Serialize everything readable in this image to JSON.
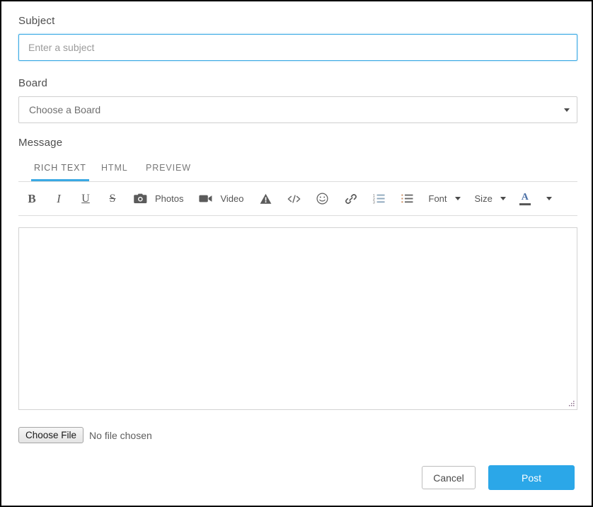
{
  "form": {
    "subject": {
      "label": "Subject",
      "placeholder": "Enter a subject",
      "value": "",
      "focus_border_color": "#3aa9e4"
    },
    "board": {
      "label": "Board",
      "selected": "Choose a Board",
      "arrow_icon": "chevron-down-icon"
    },
    "message": {
      "label": "Message",
      "tabs": [
        {
          "label": "RICH TEXT",
          "active": true
        },
        {
          "label": "HTML",
          "active": false
        },
        {
          "label": "PREVIEW",
          "active": false
        }
      ],
      "active_tab_underline_color": "#3aa9e4",
      "toolbar": [
        {
          "name": "bold-button",
          "icon": "bold-icon",
          "glyph": "B",
          "label": ""
        },
        {
          "name": "italic-button",
          "icon": "italic-icon",
          "glyph": "I",
          "label": ""
        },
        {
          "name": "underline-button",
          "icon": "underline-icon",
          "glyph": "U",
          "label": ""
        },
        {
          "name": "strikethrough-button",
          "icon": "strikethrough-icon",
          "glyph": "S",
          "label": ""
        },
        {
          "name": "photos-button",
          "icon": "camera-icon",
          "label": "Photos"
        },
        {
          "name": "video-button",
          "icon": "video-camera-icon",
          "label": "Video"
        },
        {
          "name": "spoiler-button",
          "icon": "warning-triangle-icon",
          "label": ""
        },
        {
          "name": "code-button",
          "icon": "code-icon",
          "label": ""
        },
        {
          "name": "emoji-button",
          "icon": "smiley-face-icon",
          "label": ""
        },
        {
          "name": "link-button",
          "icon": "link-icon",
          "label": ""
        },
        {
          "name": "ordered-list-button",
          "icon": "ordered-list-icon",
          "label": ""
        },
        {
          "name": "unordered-list-button",
          "icon": "bulleted-list-icon",
          "label": ""
        },
        {
          "name": "font-dropdown",
          "icon": "chevron-down-icon",
          "label": "Font"
        },
        {
          "name": "size-dropdown",
          "icon": "chevron-down-icon",
          "label": "Size"
        },
        {
          "name": "font-color-button",
          "icon": "font-color-a-icon",
          "label": "A"
        },
        {
          "name": "font-color-dropdown",
          "icon": "chevron-down-icon",
          "label": ""
        }
      ],
      "editor": {
        "value": "",
        "placeholder": ""
      }
    },
    "attachment": {
      "button_label": "Choose File",
      "status": "No file chosen"
    }
  },
  "footer": {
    "cancel_label": "Cancel",
    "post_label": "Post",
    "post_color": "#2ba7e8"
  }
}
